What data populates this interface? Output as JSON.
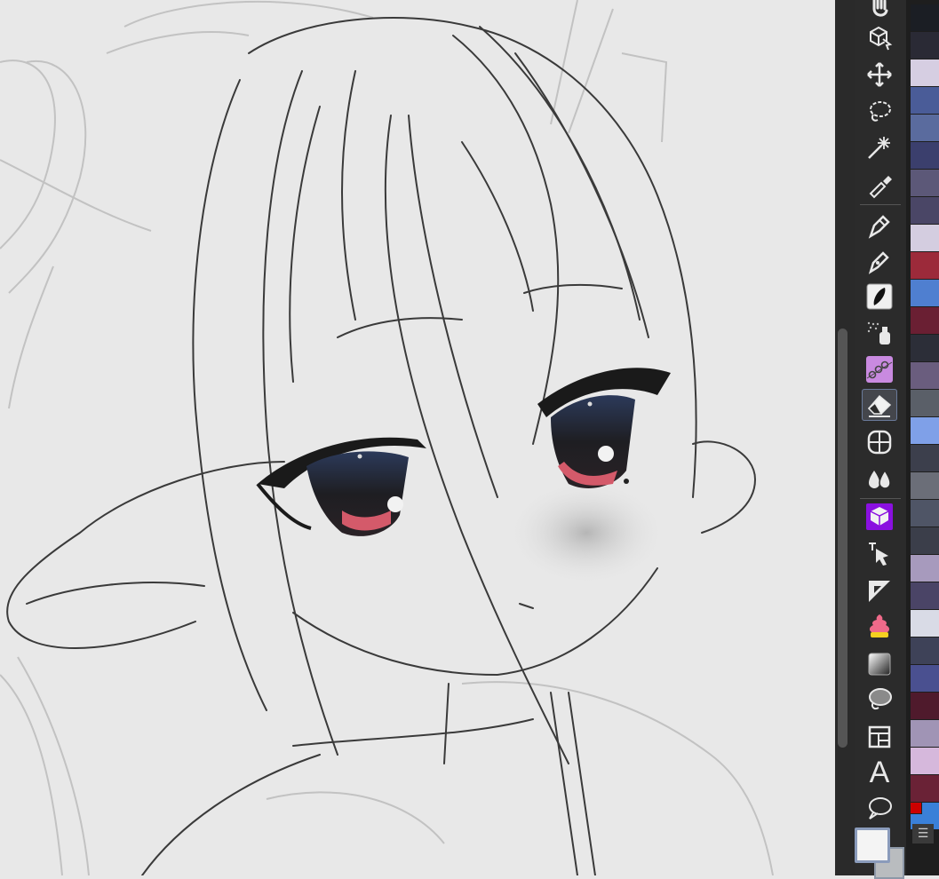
{
  "app": {
    "canvas_label": ""
  },
  "toolbar": {
    "tools": [
      {
        "id": "hand",
        "icon": "hand-icon"
      },
      {
        "id": "3d-object",
        "icon": "cube-cursor-icon"
      },
      {
        "id": "move",
        "icon": "move-arrows-icon"
      },
      {
        "id": "lasso",
        "icon": "lasso-icon"
      },
      {
        "id": "magic-wand",
        "icon": "magic-wand-icon"
      },
      {
        "id": "eyedropper",
        "icon": "eyedropper-icon"
      },
      {
        "id": "pen",
        "icon": "pen-nib-icon"
      },
      {
        "id": "pencil",
        "icon": "pencil-icon"
      },
      {
        "id": "brush",
        "icon": "brush-icon"
      },
      {
        "id": "airbrush",
        "icon": "airbrush-icon"
      },
      {
        "id": "decoration",
        "icon": "decoration-icon"
      },
      {
        "id": "eraser",
        "icon": "eraser-icon",
        "active": true
      },
      {
        "id": "blend",
        "icon": "blend-icon"
      },
      {
        "id": "fill",
        "icon": "fill-drops-icon"
      },
      {
        "id": "3d-primitive",
        "icon": "hex-prism-icon"
      },
      {
        "id": "operation",
        "icon": "operation-arrow-icon"
      },
      {
        "id": "ruler",
        "icon": "ruler-triangle-icon"
      },
      {
        "id": "text-style",
        "icon": "layered-swirl-icon"
      },
      {
        "id": "gradient",
        "icon": "gradient-icon"
      },
      {
        "id": "fill-shape",
        "icon": "fill-shape-icon"
      },
      {
        "id": "frame",
        "icon": "frame-icon"
      },
      {
        "id": "text",
        "icon": "text-a-icon",
        "label": "A"
      },
      {
        "id": "balloon",
        "icon": "speech-balloon-icon"
      }
    ]
  },
  "palette": {
    "colors": [
      "#1b1e24",
      "#2a2a35",
      "#d6cee2",
      "#4a5c98",
      "#5a6b9e",
      "#3b3f6d",
      "#5c5878",
      "#4a4666",
      "#d4cde0",
      "#9c2a3a",
      "#4f7fd0",
      "#6a1f33",
      "#2c2e38",
      "#6a5d7e",
      "#5a5f68",
      "#7fa0e8",
      "#3c3f4c",
      "#6b6e78",
      "#4f5566",
      "#3b3e4a",
      "#a79abd",
      "#4a4466",
      "#d9dbe6",
      "#3e4258",
      "#4a5090",
      "#4f1a2c",
      "#a094b5",
      "#d6b8dc",
      "#6a2236",
      "#3a80d8"
    ],
    "indicator_color": "#cc0000"
  },
  "colors": {
    "foreground": "#f4f4f4",
    "background": "#b9bcbf"
  },
  "menu": {
    "icon": "menu-lines-icon",
    "label": "☰"
  }
}
